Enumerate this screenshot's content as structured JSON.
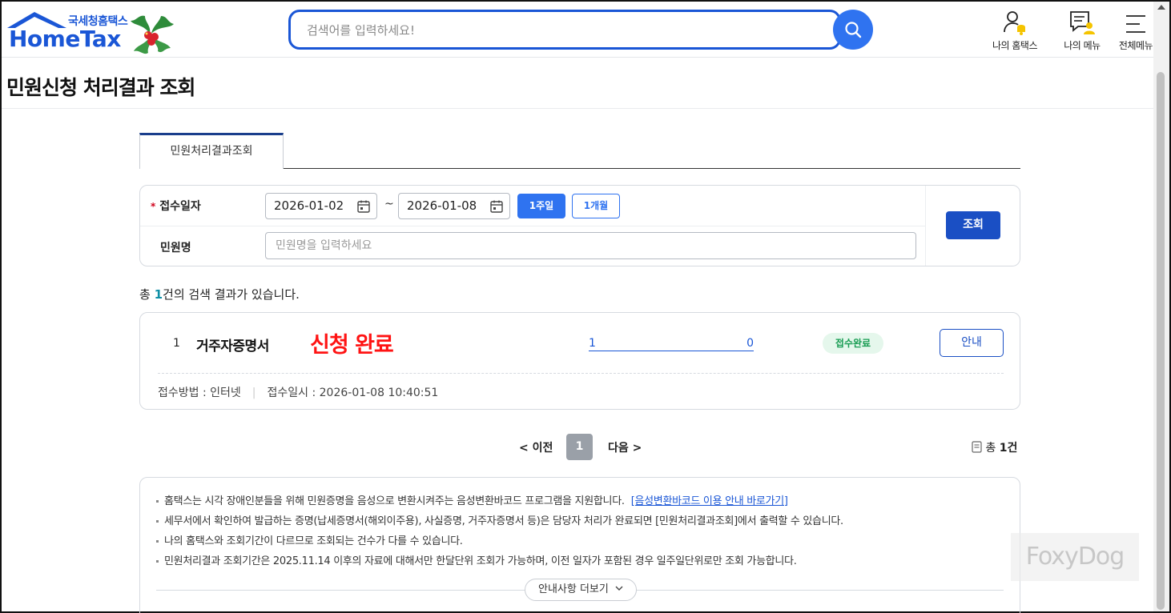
{
  "header": {
    "logo_sub": "국세청홈택스",
    "logo_main": "HomeTax",
    "search_placeholder": "검색어를 입력하세요!",
    "links": [
      {
        "label": "나의 홈택스",
        "icon": "user-bell-icon"
      },
      {
        "label": "나의 메뉴",
        "icon": "menu-user-icon"
      },
      {
        "label": "전체메뉴",
        "icon": "hamburger-icon"
      }
    ]
  },
  "page": {
    "title": "민원신청 처리결과 조회"
  },
  "tabs": [
    {
      "label": "민원처리결과조회",
      "active": true
    }
  ],
  "form": {
    "date_label": "접수일자",
    "required_mark": "*",
    "date_from": "2026-01-02",
    "tilde": "~",
    "date_to": "2026-01-08",
    "btn_week": "1주일",
    "btn_month": "1개월",
    "name_label": "민원명",
    "name_placeholder": "민원명을 입력하세요",
    "search_btn": "조회"
  },
  "results": {
    "summary_prefix": "총 ",
    "summary_count": "1",
    "summary_suffix": "건의 검색 결과가 있습니다.",
    "items": [
      {
        "num": "1",
        "name": "거주자증명서",
        "note": "신청 완료",
        "link_left": "1",
        "link_right": "0",
        "status": "접수완료",
        "btn": "안내",
        "method": "접수방법 : 인터넷",
        "date": "접수일시 : 2026-01-08 10:40:51"
      }
    ]
  },
  "pagination": {
    "prev": "이전",
    "current": "1",
    "next": "다음",
    "total_prefix": "총 ",
    "total_value": "1건"
  },
  "notice": {
    "items": [
      "홈택스는 시각 장애인분들을 위해 민원증명을 음성으로 변환시켜주는 음성변환바코드 프로그램을 지원합니다.",
      "세무서에서 확인하여 발급하는 증명(납세증명서(해외이주용), 사실증명, 거주자증명서 등)은 담당자 처리가 완료되면 [민원처리결과조회]에서 출력할 수 있습니다.",
      "나의 홈택스와 조회기간이 다르므로 조회되는 건수가 다를 수 있습니다.",
      "민원처리결과 조회기간은 2025.11.14 이후의 자료에 대해서만 한달단위 조회가 가능하며, 이전 일자가 포함된 경우 일주일단위로만 조회 가능합니다."
    ],
    "link": "[음성변환바코드 이용 안내 바로가기]",
    "more_btn": "안내사항 더보기"
  },
  "watermark": "FoxyDog",
  "colors": {
    "brand": "#1a56d6",
    "primary_btn": "#1a4fc4",
    "status_green": "#179c52",
    "note_red": "#ff1313"
  }
}
